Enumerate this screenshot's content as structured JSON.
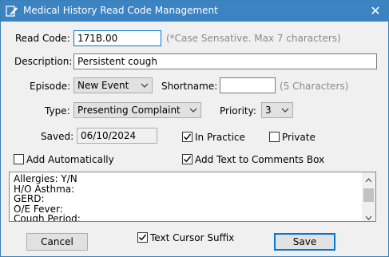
{
  "window": {
    "title": "Medical History Read Code Management",
    "close_glyph": "✕",
    "icon": "edit-pencil-icon",
    "titlebar_color": "#3b83c3"
  },
  "form": {
    "read_code_label": "Read Code:",
    "read_code_value": "171B.00",
    "read_code_hint": "(*Case Sensative. Max 7 characters)",
    "description_label": "Description:",
    "description_value": "Persistent cough",
    "episode_label": "Episode:",
    "episode_value": "New Event",
    "shortname_label": "Shortname:",
    "shortname_value": "",
    "shortname_hint": "(5 Characters)",
    "type_label": "Type:",
    "type_value": "Presenting Complaint",
    "priority_label": "Priority:",
    "priority_value": "3",
    "saved_label": "Saved:",
    "saved_value": "06/10/2024",
    "in_practice_label": "In Practice",
    "in_practice_checked": true,
    "private_label": "Private",
    "private_checked": false,
    "add_automatically_label": "Add Automatically",
    "add_automatically_checked": false,
    "add_text_label": "Add Text to Comments Box",
    "add_text_checked": true
  },
  "comments": {
    "lines": [
      "Allergies: Y/N",
      "H/O Asthma:",
      "GERD:",
      "O/E Fever:",
      "Cough Period:"
    ]
  },
  "footer": {
    "cancel_label": "Cancel",
    "text_cursor_suffix_label": "Text Cursor Suffix",
    "text_cursor_suffix_checked": true,
    "save_label": "Save"
  }
}
